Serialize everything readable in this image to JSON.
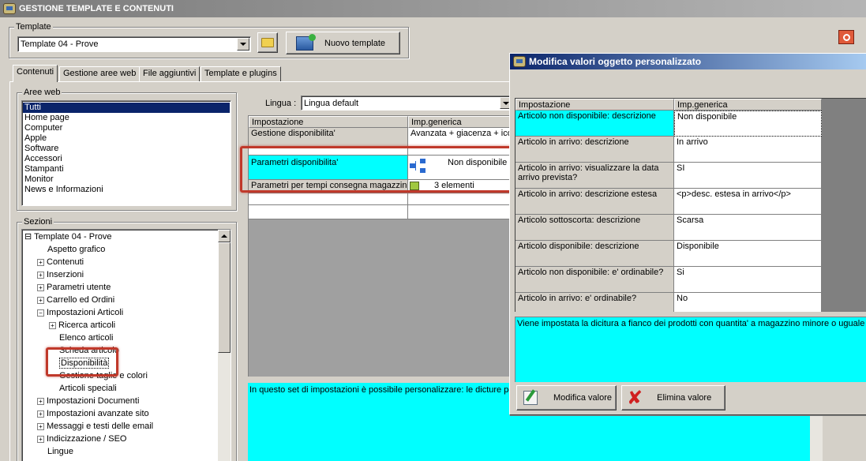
{
  "window": {
    "title": "GESTIONE TEMPLATE E CONTENUTI"
  },
  "template_group": {
    "label": "Template",
    "selected": "Template 04 - Prove",
    "new_button": "Nuovo template"
  },
  "tabs": [
    {
      "label": "Contenuti"
    },
    {
      "label": "Gestione aree web"
    },
    {
      "label": "File aggiuntivi"
    },
    {
      "label": "Template e plugins"
    }
  ],
  "aree_web": {
    "label": "Aree web",
    "items": [
      "Tutti",
      "Home page",
      "Computer",
      "Apple",
      "Software",
      "Accessori",
      "Stampanti",
      "Monitor",
      "News e Informazioni"
    ]
  },
  "sezioni": {
    "label": "Sezioni",
    "items": [
      {
        "label": "Template 04 - Prove",
        "toggle": "⊟"
      },
      {
        "label": "Aspetto grafico",
        "toggle": ""
      },
      {
        "label": "Contenuti",
        "toggle": "+"
      },
      {
        "label": "Inserzioni",
        "toggle": "+"
      },
      {
        "label": "Parametri utente",
        "toggle": "+"
      },
      {
        "label": "Carrello ed Ordini",
        "toggle": "+"
      },
      {
        "label": "Impostazioni Articoli",
        "toggle": "−"
      },
      {
        "label": "Ricerca articoli",
        "toggle": "+"
      },
      {
        "label": "Elenco articoli",
        "toggle": ""
      },
      {
        "label": "Scheda articolo",
        "toggle": ""
      },
      {
        "label": "Disponibilità",
        "toggle": ""
      },
      {
        "label": "Gestione taglie e colori",
        "toggle": ""
      },
      {
        "label": "Articoli speciali",
        "toggle": ""
      },
      {
        "label": "Impostazioni Documenti",
        "toggle": "+"
      },
      {
        "label": "Impostazioni avanzate sito",
        "toggle": "+"
      },
      {
        "label": "Messaggi e testi delle email",
        "toggle": "+"
      },
      {
        "label": "Indicizzazione / SEO",
        "toggle": "+"
      },
      {
        "label": "Lingue",
        "toggle": ""
      }
    ]
  },
  "main_grid": {
    "lingua_label": "Lingua :",
    "lingua_value": "Lingua default",
    "headers": [
      "Impostazione",
      "Imp.generica"
    ],
    "rows": [
      {
        "setting": "Gestione disponibilita'",
        "value": "Avanzata + giacenza + ico"
      },
      {
        "setting": "Parametri disponibilita'",
        "value": "Non disponibile"
      },
      {
        "setting": "Parametri per tempi consegna magazzini",
        "value": "3 elementi"
      }
    ],
    "description": "In questo set di impostazioni è possibile personalizzare: le dicture pe alla loro disponibilità, limitare l'ordine alla sole quantità disponibili a ma"
  },
  "dialog": {
    "title": "Modifica valori oggetto personalizzato",
    "headers": [
      "Impostazione",
      "Imp.generica"
    ],
    "rows": [
      {
        "setting": "Articolo non disponibile: descrizione",
        "value": "Non disponibile"
      },
      {
        "setting": "Articolo in arrivo: descrizione",
        "value": "In arrivo"
      },
      {
        "setting": "Articolo in arrivo: visualizzare la data arrivo prevista?",
        "value": "SI"
      },
      {
        "setting": "Articolo in arrivo: descrizione estesa",
        "value": "<p>desc. estesa in arrivo</p>"
      },
      {
        "setting": "Articolo sottoscorta: descrizione",
        "value": "Scarsa"
      },
      {
        "setting": "Articolo disponibile: descrizione",
        "value": "Disponibile"
      },
      {
        "setting": "Articolo non disponibile: e' ordinabile?",
        "value": "Si"
      },
      {
        "setting": "Articolo in arrivo: e' ordinabile?",
        "value": "No"
      }
    ],
    "description": "Viene impostata la dicitura a fianco dei prodotti con quantita' a magazzino minore o uguale a",
    "modify_button": "Modifica valore",
    "delete_button": "Elimina valore"
  },
  "colors": {
    "highlight": "#00ffff",
    "selection": "#0a246a",
    "annotation": "#c0392b"
  }
}
